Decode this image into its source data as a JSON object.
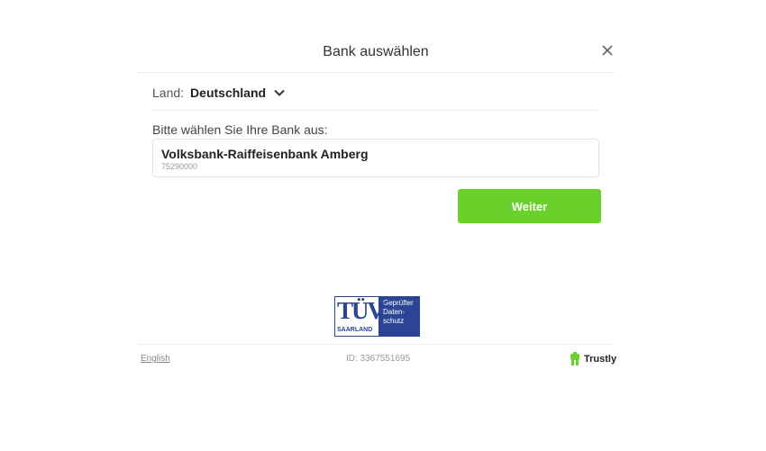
{
  "dialog": {
    "title": "Bank auswählen",
    "close_icon": "close-icon"
  },
  "country": {
    "label": "Land:",
    "value": "Deutschland",
    "icon": "chevron-down-icon"
  },
  "bank_select": {
    "prompt": "Bitte wählen Sie Ihre Bank aus:",
    "name": "Volksbank-Raiffeisenbank Amberg",
    "code": "75290000"
  },
  "actions": {
    "next_label": "Weiter",
    "accent_color": "#6ad12c"
  },
  "seal": {
    "logo_text": "TÜV",
    "logo_sub": "SAARLAND",
    "caption": "Geprüfter Daten-schutz"
  },
  "footer": {
    "language_link": "English",
    "id_text": "ID: 3367551695",
    "brand": "Trustly"
  }
}
